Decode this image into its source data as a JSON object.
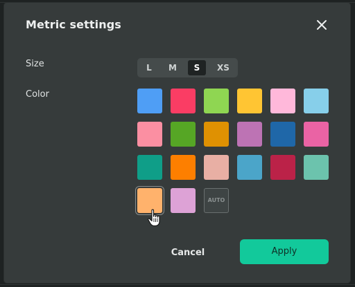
{
  "dialog": {
    "title": "Metric settings",
    "close_icon": "close-icon"
  },
  "size": {
    "label": "Size",
    "options": [
      "L",
      "M",
      "S",
      "XS"
    ],
    "selected": "S"
  },
  "color": {
    "label": "Color",
    "swatches": [
      "#4f9ef5",
      "#fa3d64",
      "#8fd652",
      "#ffc533",
      "#ffb8da",
      "#87cfea",
      "#fb8fa2",
      "#56a625",
      "#df9102",
      "#bd73b4",
      "#1f67a8",
      "#ea63a4",
      "#0f9e88",
      "#fd7f00",
      "#e8afa4",
      "#4ba5c9",
      "#bb2248",
      "#6cc3ad",
      "#ffb26c",
      "#dda2d6"
    ],
    "selected_index": 18,
    "auto_label": "AUTO"
  },
  "actions": {
    "cancel_label": "Cancel",
    "apply_label": "Apply"
  },
  "theme": {
    "accent": "#12c99b",
    "dialog_bg": "#363b3b"
  }
}
